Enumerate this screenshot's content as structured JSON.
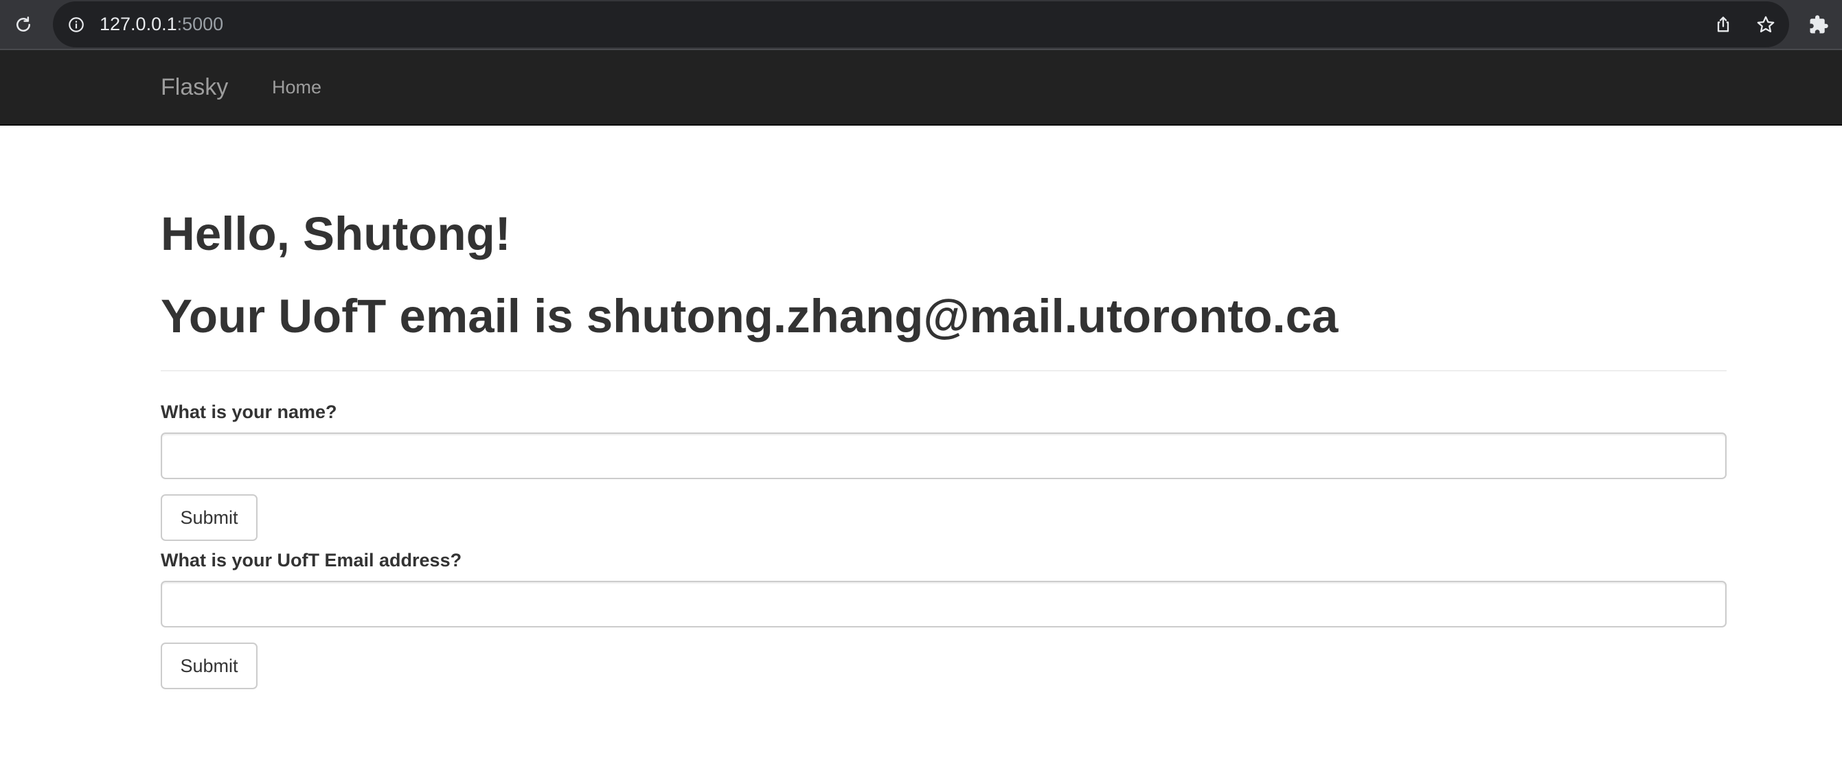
{
  "browser": {
    "url_host": "127.0.0.1",
    "url_port": ":5000",
    "icons": {
      "reload": "reload-icon",
      "info": "info-icon",
      "share": "share-icon",
      "bookmark": "star-icon",
      "extensions": "puzzle-icon"
    }
  },
  "navbar": {
    "brand": "Flasky",
    "links": [
      {
        "label": "Home"
      }
    ]
  },
  "main": {
    "greeting": "Hello, Shutong!",
    "email_line": "Your UofT email is shutong.zhang@mail.utoronto.ca",
    "forms": [
      {
        "label": "What is your name?",
        "value": "",
        "submit_label": "Submit"
      },
      {
        "label": "What is your UofT Email address?",
        "value": "",
        "submit_label": "Submit"
      }
    ]
  },
  "colors": {
    "browser_frame": "#35363a",
    "omnibox": "#202124",
    "navbar": "#222222",
    "navbar_text": "#9d9d9d",
    "heading_text": "#333333",
    "input_border": "#cccccc"
  }
}
